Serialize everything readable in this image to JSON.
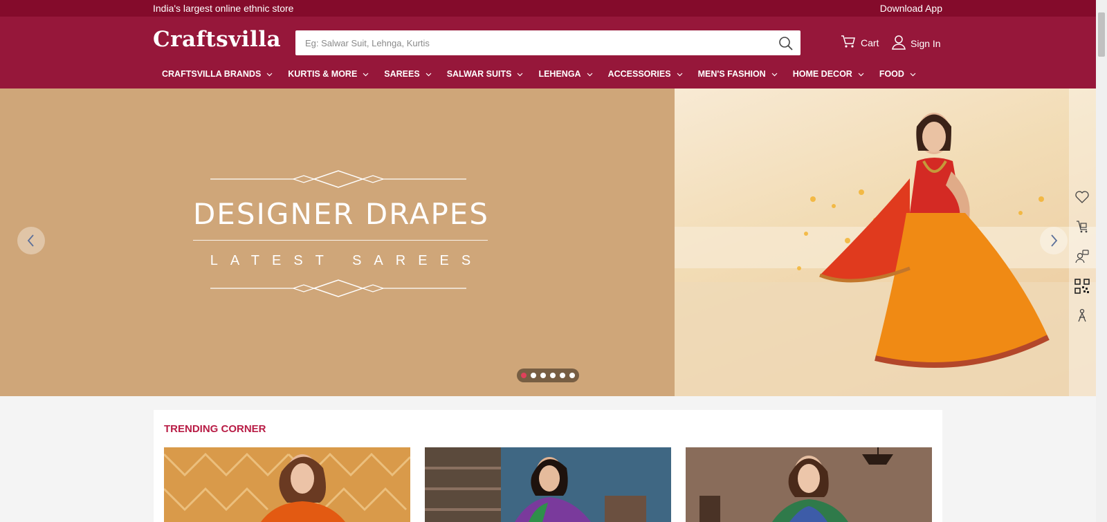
{
  "top_strip": {
    "tagline": "India's largest online ethnic store",
    "download_label": "Download App"
  },
  "header": {
    "logo": "Craftsvilla",
    "search": {
      "placeholder": "Eg: Salwar Suit, Lehnga, Kurtis",
      "value": ""
    },
    "cart_label": "Cart",
    "signin_label": "Sign In"
  },
  "nav": {
    "items": [
      {
        "label": "CRAFTSVILLA BRANDS"
      },
      {
        "label": "KURTIS & MORE"
      },
      {
        "label": "SAREES"
      },
      {
        "label": "SALWAR SUITS"
      },
      {
        "label": "LEHENGA"
      },
      {
        "label": "ACCESSORIES"
      },
      {
        "label": "MEN'S FASHION"
      },
      {
        "label": "HOME DECOR"
      },
      {
        "label": "FOOD"
      }
    ]
  },
  "hero": {
    "title": "DESIGNER DRAPES",
    "subtitle": "LATEST SAREES",
    "slide_count": 6,
    "active_slide": 1
  },
  "side_rail": {
    "icons": [
      "heart-icon",
      "cart-person-icon",
      "chat-support-icon",
      "qr-code-icon",
      "person-tag-icon"
    ]
  },
  "trending": {
    "title": "TRENDING CORNER"
  },
  "colors": {
    "brand": "#96173a",
    "brand_dark": "#840b2b",
    "banner": "#cfa679",
    "accent": "#b81c45"
  }
}
